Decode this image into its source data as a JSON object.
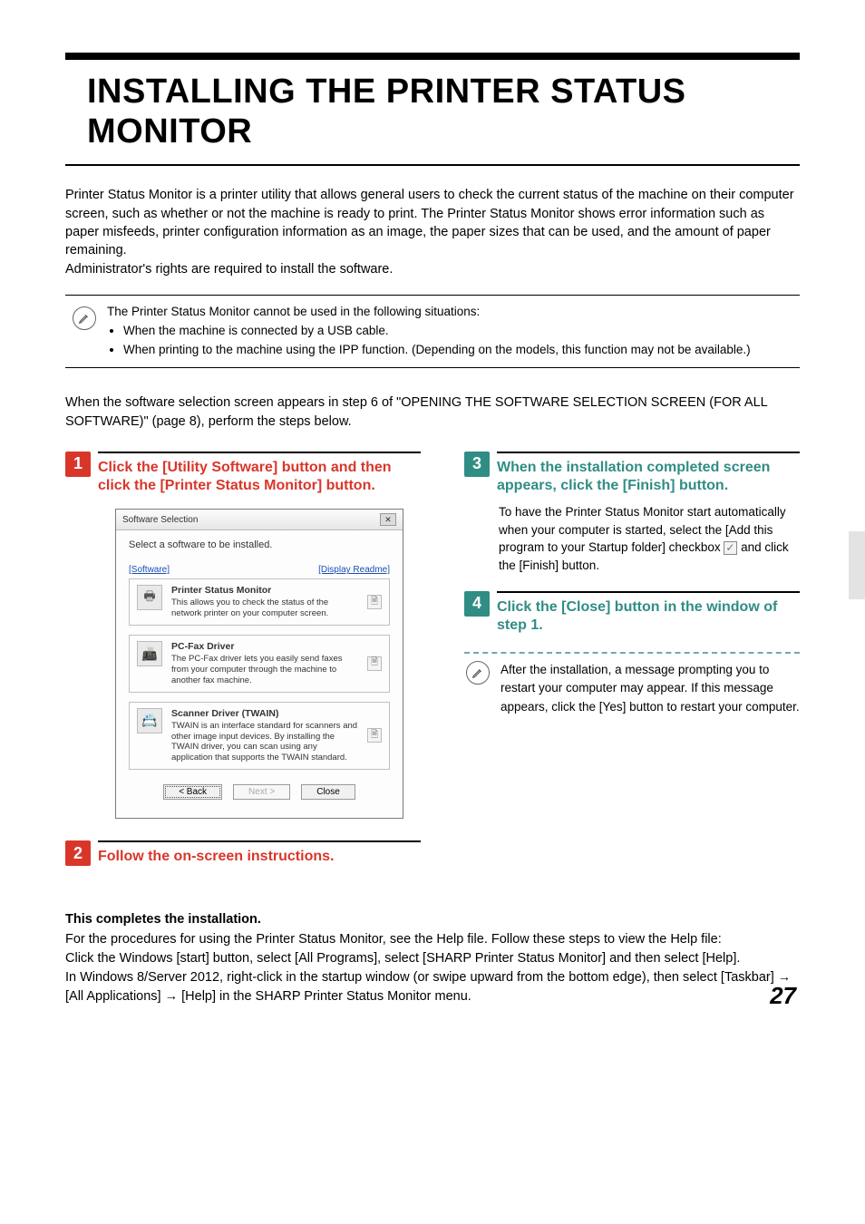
{
  "title": "INSTALLING THE PRINTER STATUS MONITOR",
  "intro": "Printer Status Monitor is a printer utility that allows general users to check the current status of the machine on their computer screen, such as whether or not the machine is ready to print. The Printer Status Monitor shows error information such as paper misfeeds, printer configuration information as an image, the paper sizes that can be used, and the amount of paper remaining.\nAdministrator's rights are required to install the software.",
  "note": {
    "lead": "The Printer Status Monitor cannot be used in the following situations:",
    "b1": "When the machine is connected by a USB cable.",
    "b2": "When printing to the machine using the IPP function. (Depending on the models,  this function may not be available.)"
  },
  "reference": "When the software selection screen appears in step 6 of \"OPENING THE SOFTWARE SELECTION SCREEN (FOR ALL SOFTWARE)\" (page 8), perform the steps below.",
  "step1": {
    "num": "1",
    "head": "Click the [Utility Software] button and then click the [Printer Status Monitor] button."
  },
  "step2": {
    "num": "2",
    "head": "Follow the on-screen instructions."
  },
  "step3": {
    "num": "3",
    "head": "When the installation completed screen appears, click the [Finish] button.",
    "body_a": "To have the Printer Status Monitor start automatically when your computer is started, select the [Add this program to your Startup folder] checkbox ",
    "body_b": " and click the [Finish] button."
  },
  "step4": {
    "num": "4",
    "head": "Click the [Close] button in the window of step 1.",
    "info": "After the installation, a message prompting you to restart your computer may appear. If this message appears, click the [Yes] button to restart your computer."
  },
  "dialog": {
    "title": "Software Selection",
    "close": "—",
    "subtitle": "Select a software to be installed.",
    "left_link": "[Software]",
    "right_link": "[Display Readme]",
    "items": [
      {
        "icon": "🖶",
        "title": "Printer Status Monitor",
        "desc": "This allows you to check the status of the network printer on your computer screen."
      },
      {
        "icon": "📠",
        "title": "PC-Fax Driver",
        "desc": "The PC-Fax driver lets you easily send faxes from your computer through the machine to another fax machine."
      },
      {
        "icon": "📇",
        "title": "Scanner Driver (TWAIN)",
        "desc": "TWAIN is an interface standard for scanners and other image input devices. By installing the TWAIN driver, you can scan using any application that supports the TWAIN standard."
      }
    ],
    "btn_back": "< Back",
    "btn_next": "Next >",
    "btn_close": "Close"
  },
  "completion": {
    "head": "This completes the installation.",
    "body": "For the procedures for using the Printer Status Monitor, see the Help file. Follow these steps to view the Help file:\nClick the Windows [start] button, select [All Programs], select [SHARP Printer Status Monitor] and then select [Help].\nIn Windows 8/Server 2012, right-click in the startup window (or swipe upward from the bottom edge), then select [Taskbar] → [All Applications] → [Help] in the SHARP Printer Status Monitor menu."
  },
  "page_number": "27"
}
